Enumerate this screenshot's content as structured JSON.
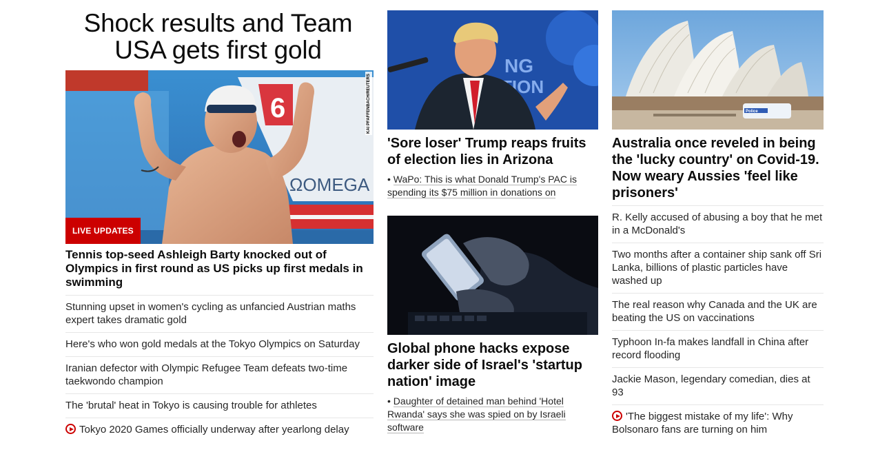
{
  "column1": {
    "title": "Shock results and Team USA gets first gold",
    "image_credit": "KAI PFAFFENBACH/REUTERS",
    "badge": "LIVE UPDATES",
    "lead_headline": "Tennis top-seed Ashleigh Barty knocked out of Olympics in first round as US picks up first medals in swimming",
    "items": [
      "Stunning upset in women's cycling as unfancied Austrian maths expert takes dramatic gold",
      "Here's who won gold medals at the Tokyo Olympics on Saturday",
      "Iranian defector with Olympic Refugee Team defeats two-time taekwondo champion",
      "The 'brutal' heat in Tokyo is causing trouble for athletes"
    ],
    "video_item": "Tokyo 2020 Games officially underway after yearlong delay"
  },
  "column2": {
    "card1": {
      "headline": "'Sore loser' Trump reaps fruits of election lies in Arizona",
      "sub": "WaPo: This is what Donald Trump's PAC is spending its $75 million in donations on"
    },
    "card2": {
      "headline": "Global phone hacks expose darker side of Israel's 'startup nation' image",
      "sub": "Daughter of detained man behind 'Hotel Rwanda' says she was spied on by Israeli software"
    }
  },
  "column3": {
    "headline": "Australia once reveled in being the 'lucky country' on Covid-19. Now weary Aussies 'feel like prisoners'",
    "items": [
      "R. Kelly accused of abusing a boy that he met in a McDonald's",
      "Two months after a container ship sank off Sri Lanka, billions of plastic particles have washed up",
      "The real reason why Canada and the UK are beating the US on vaccinations",
      "Typhoon In-fa makes landfall in China after record flooding",
      "Jackie Mason, legendary comedian, dies at 93"
    ],
    "video_item": "'The biggest mistake of my life': Why Bolsonaro fans are turning on him"
  },
  "colors": {
    "accent": "#cc0000",
    "headline": "#0c0c0c",
    "body_text": "#262626",
    "divider": "#e6e6e6"
  },
  "icons": {
    "video": "play-circle-icon"
  }
}
